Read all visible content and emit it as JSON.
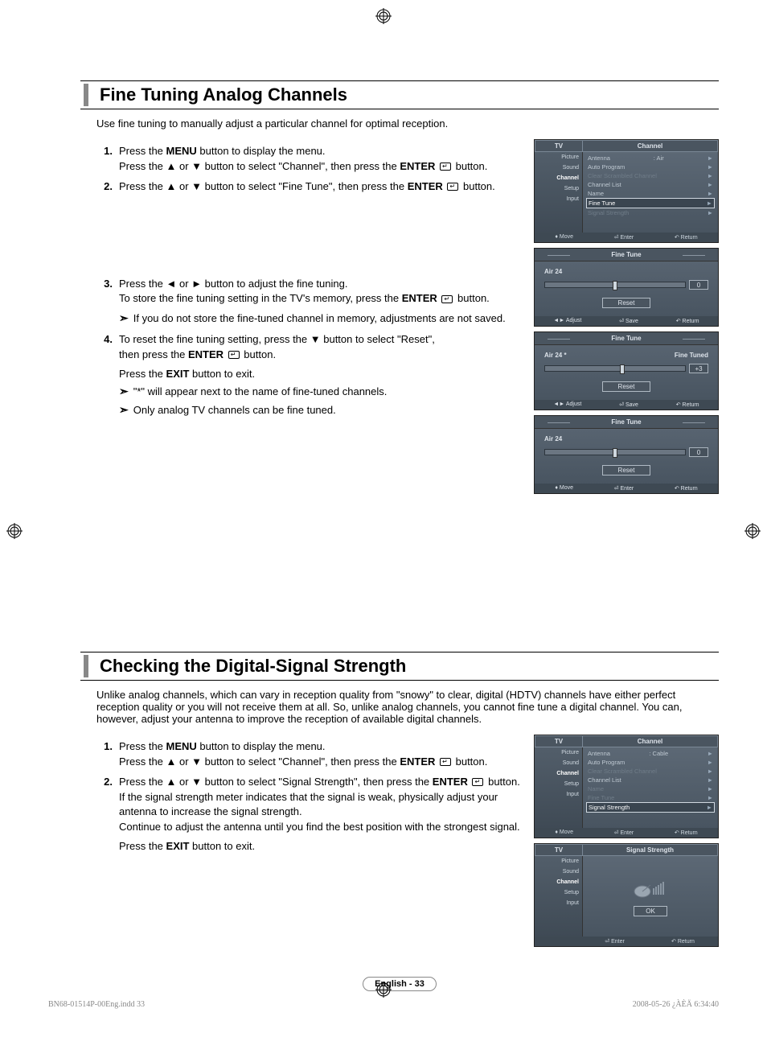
{
  "section1": {
    "title": "Fine Tuning Analog Channels",
    "intro": "Use fine tuning to manually adjust a particular channel for optimal reception.",
    "steps": {
      "s1a": "Press the ",
      "s1b": " button to display the menu.",
      "s1c": "Press the ▲ or ▼ button to select \"Channel\", then press the ",
      "s1d": " button.",
      "s2": "Press the ▲ or ▼ button to select \"Fine Tune\", then press the ",
      "s2b": " button.",
      "s3a": "Press the ◄ or ► button to adjust the fine tuning.",
      "s3b": "To store the fine tuning setting in the TV's memory, press the ",
      "s3c": " button.",
      "s3note": "If you do not store the fine-tuned channel in memory, adjustments are not saved.",
      "s4a": "To reset the fine tuning setting, press the ▼ button to select \"Reset\",",
      "s4b": "then press  the ",
      "s4c": " button.",
      "exit1": "Press the ",
      "exit2": " button to exit.",
      "noteA": "\"*\" will appear next to the name of fine-tuned channels.",
      "noteB": "Only analog TV channels can be fine tuned."
    },
    "labels": {
      "menu": "MENU",
      "enter": "ENTER",
      "exit": "EXIT"
    }
  },
  "section2": {
    "title": "Checking the Digital-Signal Strength",
    "intro": "Unlike analog channels, which can vary in reception quality from \"snowy\" to clear, digital (HDTV) channels have either perfect reception quality or you will not receive them at all. So, unlike analog channels, you cannot fine tune a digital channel. You can, however, adjust your antenna to improve the reception of available digital channels.",
    "steps": {
      "s1a": "Press the ",
      "s1b": " button to display the menu.",
      "s1c": "Press the ▲ or ▼ button to select \"Channel\", then press the ",
      "s1d": " button.",
      "s2a": "Press the ▲ or ▼ button to select \"Signal Strength\", then press the ",
      "s2b": "button.",
      "s2c": "If the signal strength meter indicates that the signal is weak, physically adjust your antenna to increase the signal strength.",
      "s2d": "Continue to adjust the antenna until you find the best position with the strongest signal.",
      "exit1": "Press the ",
      "exit2": " button to exit."
    },
    "labels": {
      "menu": "MENU",
      "enter": "ENTER",
      "exit": "EXIT"
    }
  },
  "osd": {
    "tv": "TV",
    "channel": "Channel",
    "sidebar": [
      "Picture",
      "Sound",
      "Channel",
      "Setup",
      "Input"
    ],
    "menuA": {
      "antenna": "Antenna",
      "antenna_val": ": Air",
      "items": [
        "Auto Program",
        "Clear Scrambled Channel",
        "Channel List",
        "Name",
        "Fine Tune",
        "Signal Strength"
      ],
      "highlight": "Fine Tune"
    },
    "menuB": {
      "antenna": "Antenna",
      "antenna_val": ": Cable",
      "items": [
        "Auto Program",
        "Clear Scrambled Channel",
        "Channel List",
        "Name",
        "Fine Tune",
        "Signal Strength"
      ],
      "highlight": "Signal Strength"
    },
    "footer": {
      "move": "Move",
      "enter": "Enter",
      "return": "Return",
      "adjust": "Adjust",
      "save": "Save"
    },
    "ft": {
      "title": "Fine Tune",
      "reset": "Reset",
      "ch1": "Air 24",
      "v1": "0",
      "ch2": "Air 24 *",
      "v2": "+3",
      "ft_label": "Fine Tuned",
      "ch3": "Air 24",
      "v3": "0"
    },
    "ss": {
      "title": "Signal Strength",
      "ok": "OK"
    }
  },
  "page_label": "English - 33",
  "print_footer_left": "BN68-01514P-00Eng.indd   33",
  "print_footer_right": "2008-05-26   ¿ÀÈÄ 6:34:40"
}
